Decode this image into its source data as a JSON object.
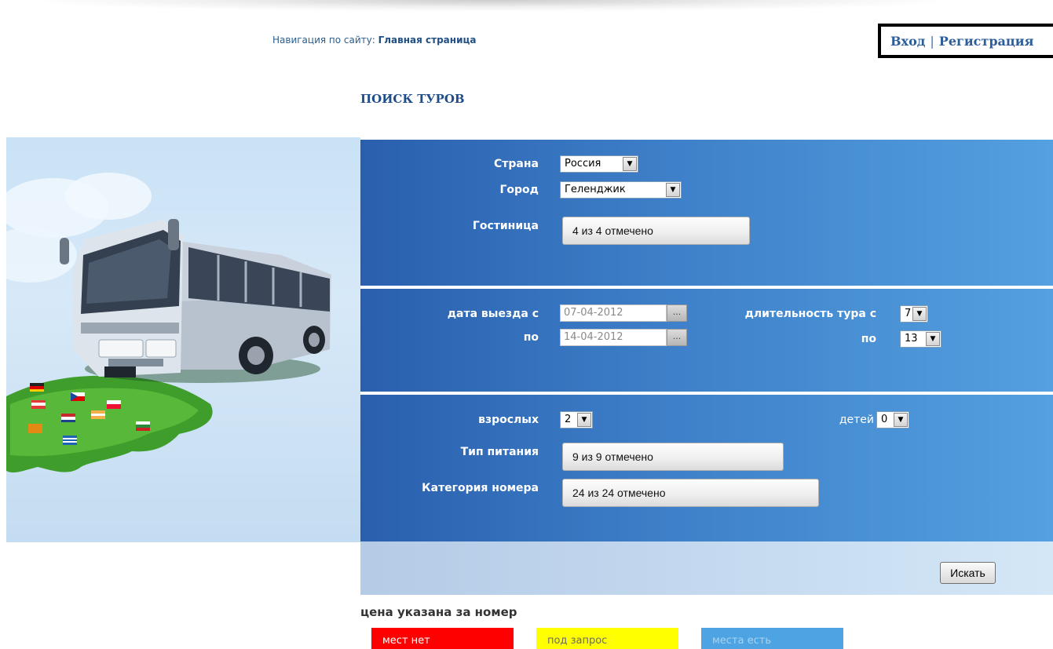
{
  "header": {
    "nav_prefix": "Навигация по сайту:",
    "nav_link": "Главная страница",
    "login": "Вход",
    "separator": "|",
    "register": "Регистрация"
  },
  "page_title": "ПОИСК ТУРОВ",
  "form": {
    "country_label": "Страна",
    "country_value": "Россия",
    "city_label": "Город",
    "city_value": "Геленджик",
    "hotel_label": "Гостиница",
    "hotel_value": "4 из 4 отмечено",
    "departure_label": "дата выезда с",
    "departure_to_label": "по",
    "departure_from": "07-04-2012",
    "departure_to": "14-04-2012",
    "date_button": "...",
    "duration_label": "длительность тура с",
    "duration_to_label": "по",
    "duration_from": "7",
    "duration_to": "13",
    "adults_label": "взрослых",
    "adults_value": "2",
    "children_label": "детей",
    "children_value": "0",
    "meal_label": "Тип питания",
    "meal_value": "9 из 9 отмечено",
    "room_label": "Категория номера",
    "room_value": "24 из 24 отмечено",
    "search_button": "Искать"
  },
  "price_note": "цена указана за номер",
  "legend": {
    "none": "мест нет",
    "request": "под запрос",
    "available": "места есть"
  },
  "colors": {
    "panel_dark": "#2a5fae",
    "panel_light": "#54a0e0",
    "legend_none": "#ff0000",
    "legend_request": "#ffff00",
    "legend_available": "#4ea3e2"
  }
}
